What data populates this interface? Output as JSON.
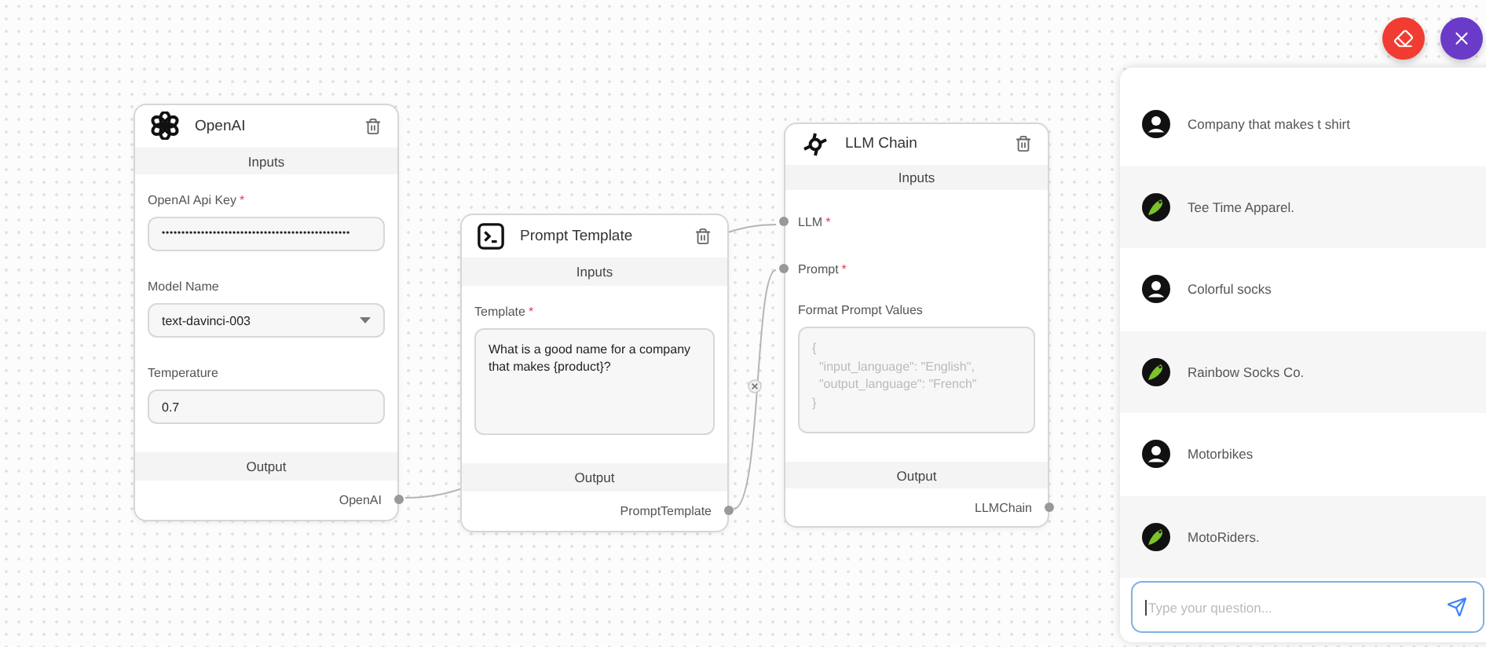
{
  "nodes": [
    {
      "kind": "openai",
      "title": "OpenAI",
      "inputs_label": "Inputs",
      "fields": [
        {
          "kind": "password",
          "label": "OpenAI Api Key",
          "required_mark": "*",
          "value": "••••••••••••••••••••••••••••••••••••••••••••••••"
        },
        {
          "kind": "select",
          "label": "Model Name",
          "value": "text-davinci-003"
        },
        {
          "kind": "text",
          "label": "Temperature",
          "value": "0.7"
        }
      ],
      "output_label": "Output",
      "output": "OpenAI"
    },
    {
      "kind": "prompt",
      "title": "Prompt Template",
      "inputs_label": "Inputs",
      "fields": [
        {
          "kind": "textarea",
          "label": "Template",
          "required_mark": "*",
          "value": "What is a good name for a company that makes {product}?"
        }
      ],
      "output_label": "Output",
      "output": "PromptTemplate"
    },
    {
      "kind": "chain",
      "title": "LLM Chain",
      "inputs_label": "Inputs",
      "anchors": [
        {
          "label": "LLM",
          "required_mark": "*"
        },
        {
          "label": "Prompt",
          "required_mark": "*"
        }
      ],
      "fields": [
        {
          "kind": "textarea",
          "label": "Format Prompt Values",
          "placeholder": "{\n  \"input_language\": \"English\",\n  \"output_language\": \"French\"\n}"
        }
      ],
      "output_label": "Output",
      "output": "LLMChain"
    }
  ],
  "chat": {
    "messages": [
      {
        "kind": "user",
        "text": "Company that makes t shirt"
      },
      {
        "kind": "bot",
        "text": "Tee Time Apparel."
      },
      {
        "kind": "user",
        "text": "Colorful socks"
      },
      {
        "kind": "bot",
        "text": "Rainbow Socks Co."
      },
      {
        "kind": "user",
        "text": "Motorbikes"
      },
      {
        "kind": "bot",
        "text": "MotoRiders."
      }
    ],
    "input": {
      "placeholder": "Type your question..."
    }
  }
}
